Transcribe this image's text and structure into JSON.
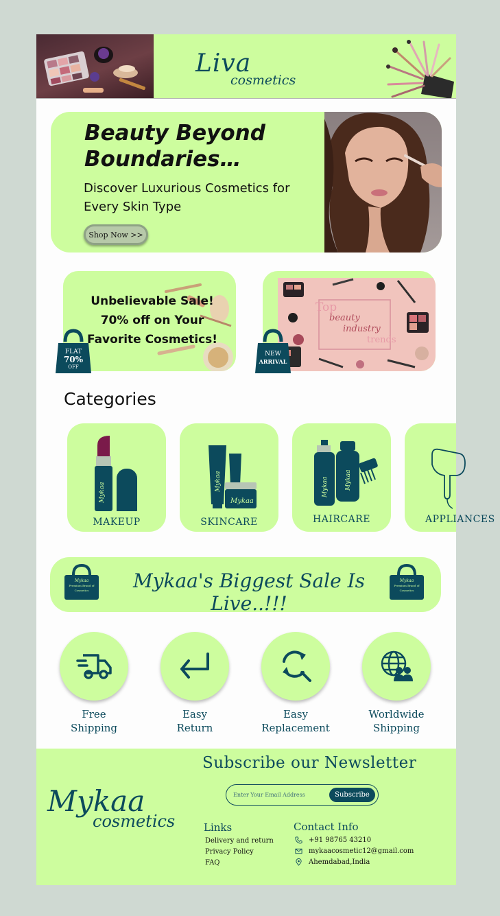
{
  "header": {
    "brand_main": "Liva",
    "brand_sub": "cosmetics"
  },
  "hero": {
    "title": "Beauty Beyond Boundaries…",
    "subtitle": "Discover Luxurious Cosmetics for Every Skin Type",
    "cta": "Shop Now >>"
  },
  "promos": {
    "sale_text": "Unbelievable Sale! 70% off on Your Favorite Cosmetics!",
    "sale_tag_top": "FLAT",
    "sale_tag_value": "70%",
    "sale_tag_bottom": "OFF",
    "trends_line1": "Top",
    "trends_line2": "beauty",
    "trends_line3": "industry",
    "trends_line4": "trends",
    "new_tag_top": "NEW",
    "new_tag_bottom": "ARRIVAL"
  },
  "categories": {
    "title": "Categories",
    "items": [
      {
        "label": "MAKEUP"
      },
      {
        "label": "SKINCARE"
      },
      {
        "label": "HAIRCARE"
      },
      {
        "label": "APPLIANCES"
      }
    ],
    "product_brand": "Mykaa"
  },
  "sale_banner": {
    "text": "Mykaa's Biggest Sale Is Live..!!!",
    "bag_brand": "Mykaa",
    "bag_tagline": "Premium Brand of Cosmetics"
  },
  "features": [
    {
      "line1": "Free",
      "line2": "Shipping",
      "icon": "truck-icon"
    },
    {
      "line1": "Easy",
      "line2": "Return",
      "icon": "return-arrow-icon"
    },
    {
      "line1": "Easy",
      "line2": "Replacement",
      "icon": "replacement-icon"
    },
    {
      "line1": "Worldwide",
      "line2": "Shipping",
      "icon": "globe-users-icon"
    }
  ],
  "footer": {
    "logo_main": "Mykaa",
    "logo_sub": "cosmetics",
    "newsletter_title": "Subscribe our Newsletter",
    "email_placeholder": "Enter Your Email Address",
    "subscribe_label": "Subscribe",
    "links_title": "Links",
    "links": [
      "Delivery and return",
      "Privacy Policy",
      "FAQ"
    ],
    "contact_title": "Contact Info",
    "phone": "+91 98765 43210",
    "email": "mykaacosmetic12@gmail.com",
    "address": "Ahemdabad,India"
  },
  "colors": {
    "accent_green": "#cdfd9e",
    "brand_teal": "#0c4a5c",
    "page_bg": "#cfd9d2"
  }
}
